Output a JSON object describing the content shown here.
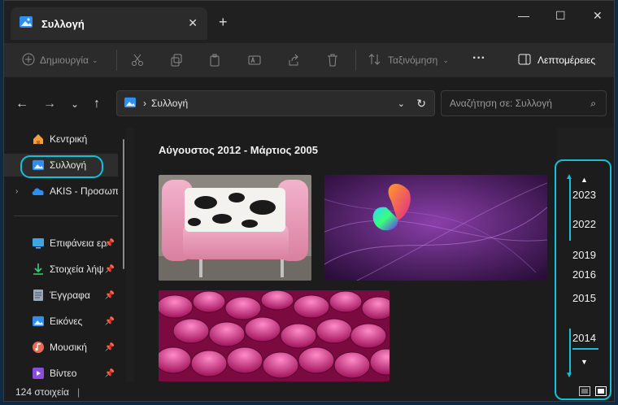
{
  "tab": {
    "title": "Συλλογή"
  },
  "toolbar": {
    "create_label": "Δημιουργία",
    "sort_label": "Ταξινόμηση",
    "more_label": "···",
    "details_label": "Λεπτομέρειες"
  },
  "address": {
    "path": "Συλλογή"
  },
  "search": {
    "placeholder": "Αναζήτηση σε: Συλλογή"
  },
  "sidebar": {
    "items": [
      {
        "label": "Κεντρική",
        "icon": "home-icon"
      },
      {
        "label": "Συλλογή",
        "icon": "gallery-icon"
      },
      {
        "label": "AKIS - Προσωπ",
        "icon": "onedrive-icon"
      },
      {
        "label": "Επιφάνεια ερ",
        "icon": "desktop-icon"
      },
      {
        "label": "Στοιχεία λήψ",
        "icon": "downloads-icon"
      },
      {
        "label": "Έγγραφα",
        "icon": "documents-icon"
      },
      {
        "label": "Εικόνες",
        "icon": "pictures-icon"
      },
      {
        "label": "Μουσική",
        "icon": "music-icon"
      },
      {
        "label": "Βίντεο",
        "icon": "videos-icon"
      }
    ]
  },
  "content": {
    "range_title": "Αύγουστος 2012 - Μάρτιος 2005"
  },
  "timeline": {
    "years": [
      "2023",
      "2022",
      "2019",
      "2016",
      "2015",
      "2014"
    ]
  },
  "status": {
    "count": "124 στοιχεία",
    "cursor": "|"
  },
  "colors": {
    "accent": "#13c0d8",
    "bg": "#1c1c1c"
  }
}
